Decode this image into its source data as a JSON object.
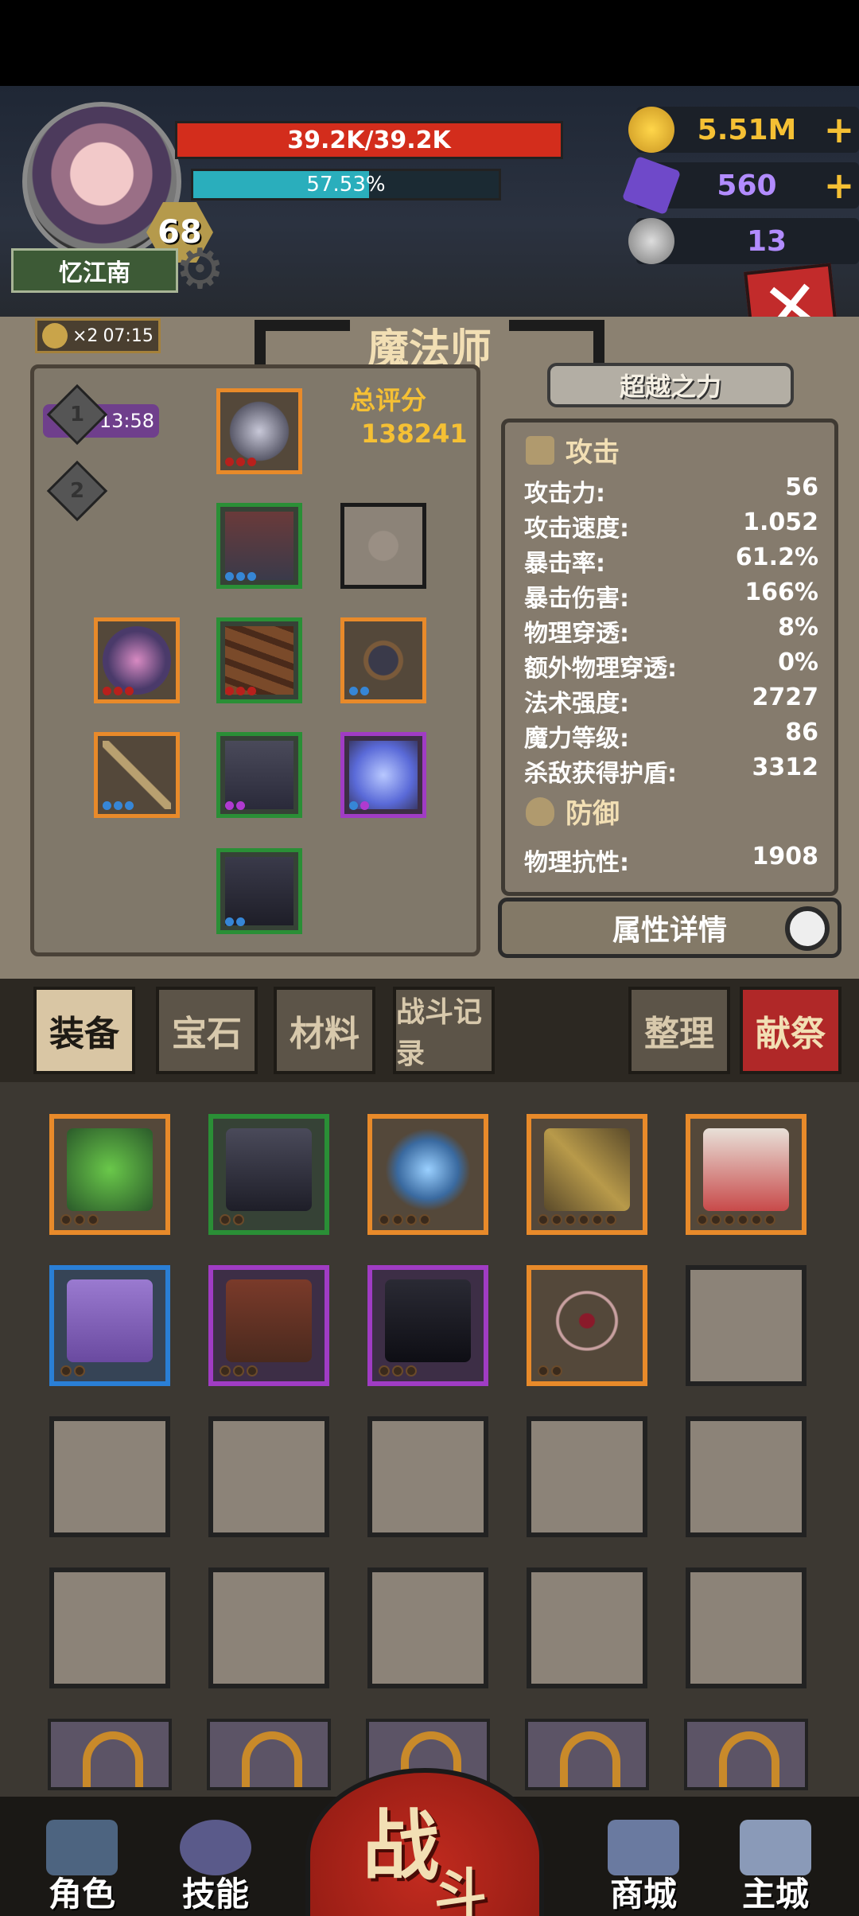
{
  "header": {
    "player_name": "忆江南",
    "level": "68",
    "hp_text": "39.2K/39.2K",
    "mp_text": "57.53%",
    "mp_fraction": 0.5753,
    "currencies": [
      {
        "icon": "gold-coin-icon",
        "value": "5.51M",
        "plus": "+"
      },
      {
        "icon": "purple-gem-icon",
        "value": "560",
        "plus": "+"
      },
      {
        "icon": "ram-skull-icon",
        "value": "13"
      }
    ],
    "close_label": "✕"
  },
  "buff": {
    "multiplier": "×2",
    "time": "07:15"
  },
  "panel": {
    "title": "魔法师",
    "score_label": "总评分",
    "score_value": "138241",
    "set_markers": [
      {
        "label": "1",
        "timer": "13:58"
      },
      {
        "label": "2"
      }
    ]
  },
  "stats": {
    "transcend_label": "超越之力",
    "attack_title": "攻击",
    "attack_rows": [
      {
        "label": "攻击力:",
        "value": "56"
      },
      {
        "label": "攻击速度:",
        "value": "1.052"
      },
      {
        "label": "暴击率:",
        "value": "61.2%"
      },
      {
        "label": "暴击伤害:",
        "value": "166%"
      },
      {
        "label": "物理穿透:",
        "value": "8%"
      },
      {
        "label": "额外物理穿透:",
        "value": "0%"
      },
      {
        "label": "法术强度:",
        "value": "2727"
      },
      {
        "label": "魔力等级:",
        "value": "86"
      },
      {
        "label": "杀敌获得护盾:",
        "value": "3312"
      }
    ],
    "defense_title": "防御",
    "defense_rows": [
      {
        "label": "物理抗性:",
        "value": "1908"
      }
    ],
    "detail_button": "属性详情"
  },
  "tabs": {
    "equipment": "装备",
    "gems": "宝石",
    "materials": "材料",
    "battle_log": "战斗记录",
    "sort": "整理",
    "sacrifice": "献祭"
  },
  "nav": {
    "character": "角色",
    "skills": "技能",
    "fight_main": "战",
    "fight_sub": "斗",
    "shop": "商城",
    "main_city": "主城"
  },
  "colors": {
    "hp": "#d32d1c",
    "mp": "#2aaebc",
    "gold": "#f5c034",
    "gem": "#b28cff",
    "rarity_orange": "#e88a2a",
    "rarity_green": "#2a8f36",
    "rarity_purple": "#a03cc4",
    "rarity_blue": "#2a7fd6"
  }
}
